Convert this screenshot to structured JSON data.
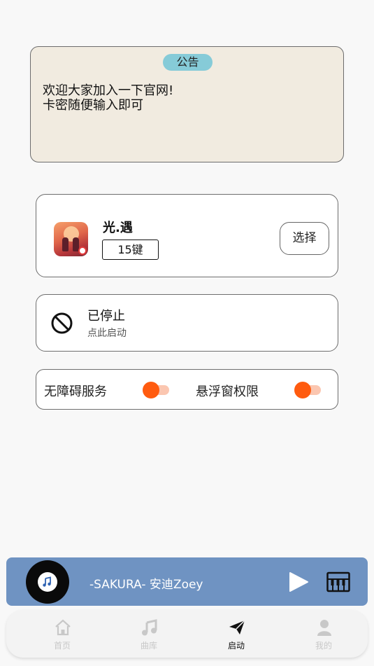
{
  "notice": {
    "tag": "公告",
    "lines": [
      "欢迎大家加入一下官网!",
      "卡密随便输入即可"
    ]
  },
  "game": {
    "name": "光.遇",
    "keys": "15键",
    "select_label": "选择",
    "icon": "game-app-icon"
  },
  "status": {
    "title": "已停止",
    "subtitle": "点此启动",
    "icon": "prohibited-icon"
  },
  "permissions": {
    "accessibility_label": "无障碍服务",
    "accessibility_enabled": false,
    "overlay_label": "悬浮窗权限",
    "overlay_enabled": false,
    "toggle_color": "#ff5b0f"
  },
  "player": {
    "song": "-SAKURA- 安迪Zoey",
    "bar_color": "#6f93c2",
    "icons": [
      "music-note-icon",
      "play-icon",
      "piano-icon"
    ]
  },
  "nav": {
    "items": [
      {
        "label": "首页",
        "icon": "home-icon",
        "active": false
      },
      {
        "label": "曲库",
        "icon": "music-library-icon",
        "active": false
      },
      {
        "label": "启动",
        "icon": "send-icon",
        "active": true
      },
      {
        "label": "我的",
        "icon": "user-icon",
        "active": false
      }
    ]
  }
}
